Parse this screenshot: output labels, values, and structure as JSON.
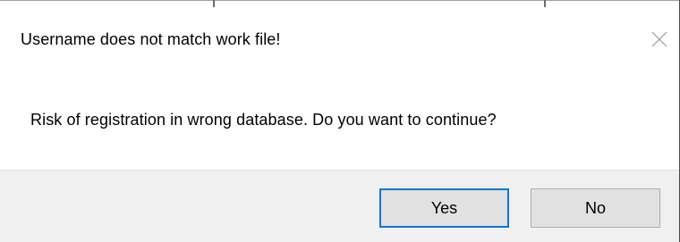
{
  "dialog": {
    "title": "Username does not match work file!",
    "message": "Risk of registration in wrong database. Do you want to continue?",
    "close_icon": "close-icon",
    "buttons": {
      "yes_label": "Yes",
      "no_label": "No"
    },
    "colors": {
      "default_button_border": "#0078d7",
      "footer_background": "#f0f0f0",
      "button_background": "#e1e1e1"
    }
  }
}
